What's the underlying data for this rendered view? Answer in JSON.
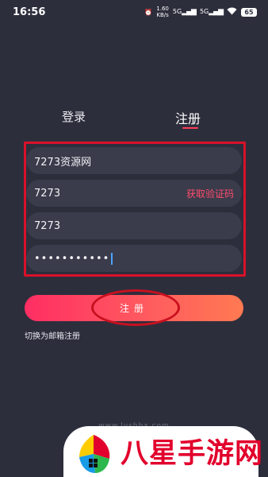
{
  "status_bar": {
    "time": "16:56",
    "speed_value": "1.60",
    "speed_unit": "KB/s",
    "network1": "5G",
    "network2": "5G",
    "battery": "65"
  },
  "tabs": {
    "login": "登录",
    "register": "注册"
  },
  "form": {
    "field1_value": "7273资源网",
    "field2_value": "7273",
    "get_code_label": "获取验证码",
    "field3_value": "7273",
    "password_dots": "•••••••••••"
  },
  "register_button_label": "注册",
  "switch_label": "切换为邮箱注册",
  "watermark": {
    "url": "www.lyshbx.com",
    "brand": "八星手游网"
  },
  "colors": {
    "background": "#2d2e3c",
    "field": "#3a3b4b",
    "accent": "#ff3f5b",
    "annotation_red": "#d9112a"
  }
}
